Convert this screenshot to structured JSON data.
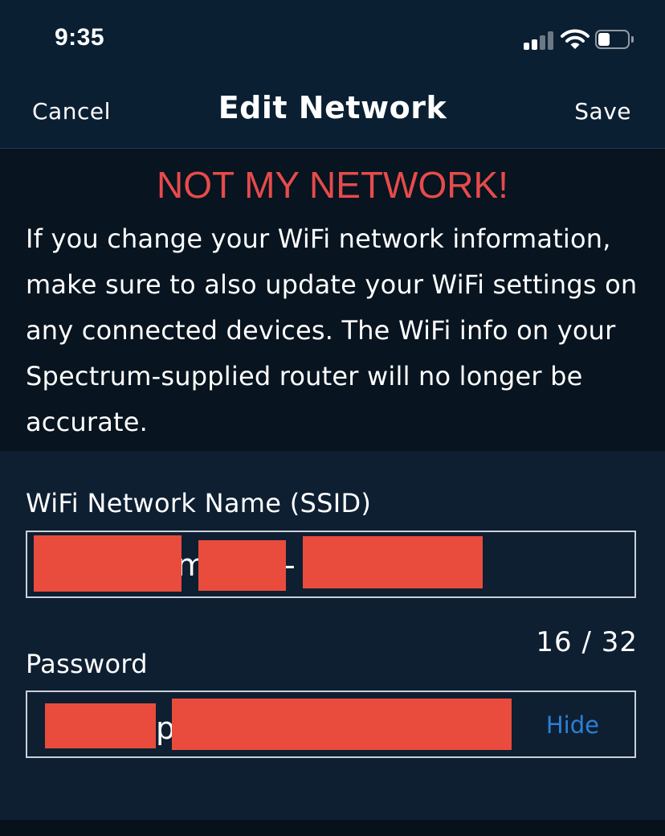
{
  "status_bar": {
    "time": "9:35",
    "signal_icon": "cellular-signal-icon",
    "wifi_icon": "wifi-icon",
    "battery_icon": "battery-icon",
    "battery_level": 0.4
  },
  "nav": {
    "cancel_label": "Cancel",
    "title": "Edit Network",
    "save_label": "Save"
  },
  "warning": {
    "title": "NOT MY NETWORK!",
    "text": "If you change your WiFi network information, make sure to also update your WiFi settings on any connected devices. The WiFi info on your Spectrum-supplied router will no longer be accurate."
  },
  "ssid_field": {
    "label": "WiFi Network Name (SSID)",
    "visible_value": "m",
    "visible_value_2": "-",
    "counter": "16 / 32"
  },
  "password_field": {
    "label": "Password",
    "visible_value": "p",
    "hide_label": "Hide"
  },
  "colors": {
    "background": "#0b1f33",
    "banner": "#08141f",
    "warning_title": "#e64b4b",
    "link": "#2d7fd6",
    "redaction": "#e94c3d"
  }
}
